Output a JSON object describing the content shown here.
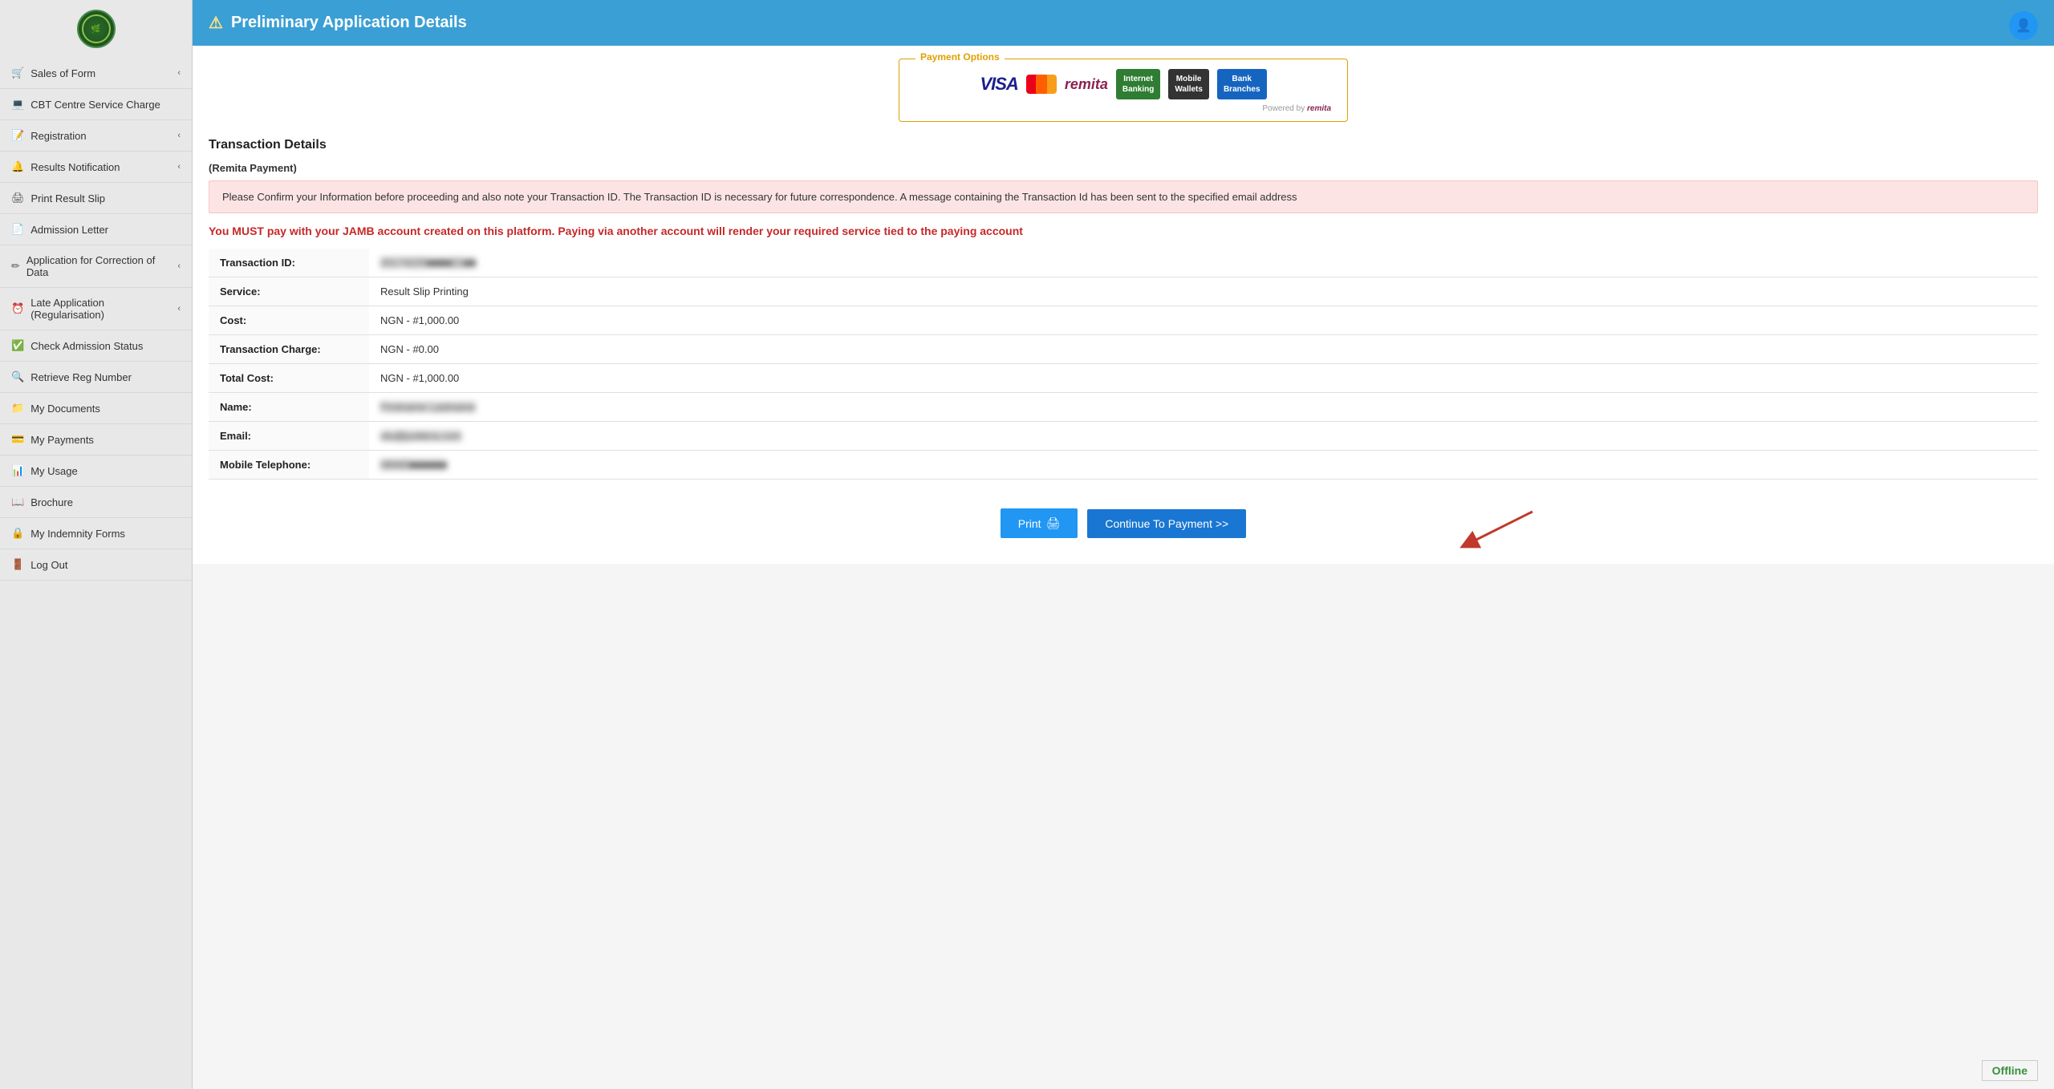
{
  "sidebar": {
    "items": [
      {
        "id": "sales-of-form",
        "label": "Sales of Form",
        "icon": "🛒",
        "hasChevron": true
      },
      {
        "id": "cbt-centre",
        "label": "CBT Centre Service Charge",
        "icon": "💻",
        "hasChevron": false
      },
      {
        "id": "registration",
        "label": "Registration",
        "icon": "📝",
        "hasChevron": true
      },
      {
        "id": "results-notification",
        "label": "Results Notification",
        "icon": "🔔",
        "hasChevron": true
      },
      {
        "id": "print-result-slip",
        "label": "Print Result Slip",
        "icon": "🖨",
        "hasChevron": false
      },
      {
        "id": "admission-letter",
        "label": "Admission Letter",
        "icon": "📄",
        "hasChevron": false
      },
      {
        "id": "application-correction",
        "label": "Application for Correction of Data",
        "icon": "✏",
        "hasChevron": true
      },
      {
        "id": "late-application",
        "label": "Late Application (Regularisation)",
        "icon": "⏰",
        "hasChevron": true
      },
      {
        "id": "check-admission",
        "label": "Check Admission Status",
        "icon": "✅",
        "hasChevron": false
      },
      {
        "id": "retrieve-reg",
        "label": "Retrieve Reg Number",
        "icon": "🔍",
        "hasChevron": false
      },
      {
        "id": "my-documents",
        "label": "My Documents",
        "icon": "📁",
        "hasChevron": false
      },
      {
        "id": "my-payments",
        "label": "My Payments",
        "icon": "💳",
        "hasChevron": false
      },
      {
        "id": "my-usage",
        "label": "My Usage",
        "icon": "📊",
        "hasChevron": false
      },
      {
        "id": "brochure",
        "label": "Brochure",
        "icon": "📖",
        "hasChevron": false
      },
      {
        "id": "my-indemnity",
        "label": "My Indemnity Forms",
        "icon": "🔒",
        "hasChevron": false
      },
      {
        "id": "log-out",
        "label": "Log Out",
        "icon": "🚪",
        "hasChevron": false
      }
    ]
  },
  "header": {
    "title": "Preliminary Application Details",
    "warn_icon": "⚠",
    "collapse_icon": "▼"
  },
  "payment_options": {
    "label": "Payment Options",
    "visa": "VISA",
    "remita": "remita",
    "internet_banking": "Internet\nBanking",
    "mobile_wallets": "Mobile\nWallets",
    "bank_branches": "Bank\nBranches",
    "powered_by": "Powered by",
    "powered_brand": "remita"
  },
  "transaction": {
    "section_title": "Transaction Details",
    "remita_label": "(Remita Payment)",
    "alert_text": "Please Confirm your Information before proceeding and also note your Transaction ID. The Transaction ID is necessary for future correspondence. A message containing the Transaction Id has been sent to the specified email address",
    "warning_text": "You MUST pay with your JAMB account created on this platform. Paying via another account will render your required service tied to the paying account",
    "rows": [
      {
        "label": "Transaction ID:",
        "value": "20174225■■■■21■■",
        "blurred": true
      },
      {
        "label": "Service:",
        "value": "Result Slip Printing",
        "blurred": false
      },
      {
        "label": "Cost:",
        "value": "NGN - #1,000.00",
        "blurred": false
      },
      {
        "label": "Transaction Charge:",
        "value": "NGN - #0.00",
        "blurred": false
      },
      {
        "label": "Total Cost:",
        "value": "NGN - #1,000.00",
        "blurred": false
      },
      {
        "label": "Name:",
        "value": "Firstname Lastname",
        "blurred": true
      },
      {
        "label": "Email:",
        "value": "olu@justtera.com",
        "blurred": true
      },
      {
        "label": "Mobile Telephone:",
        "value": "08065■■■■■■",
        "blurred": true
      }
    ]
  },
  "buttons": {
    "print": "Print",
    "continue": "Continue To Payment >>"
  },
  "offline": "Offline"
}
